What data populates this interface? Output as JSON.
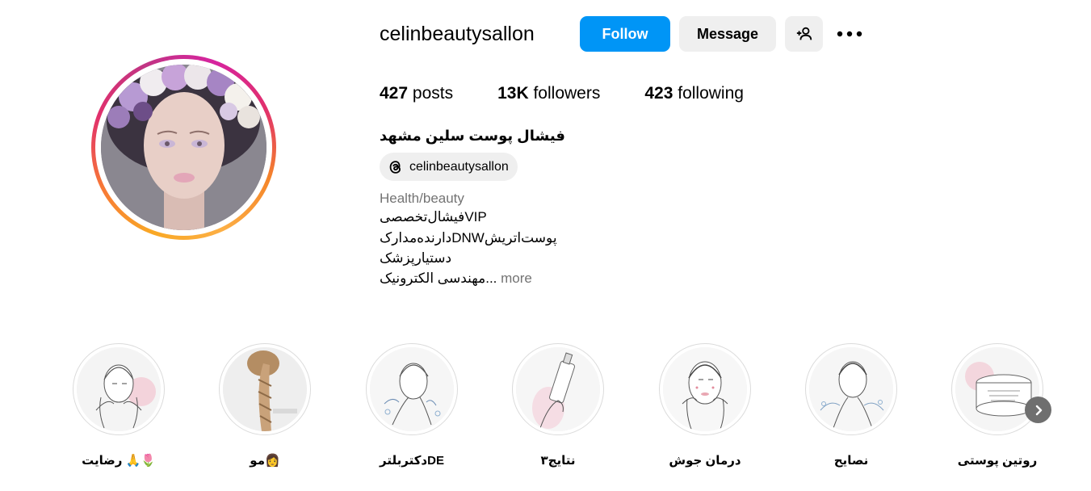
{
  "profile": {
    "username": "celinbeautysallon",
    "follow_label": "Follow",
    "message_label": "Message",
    "posts_count": "427",
    "posts_label": "posts",
    "followers_count": "13K",
    "followers_label": "followers",
    "following_count": "423",
    "following_label": "following",
    "full_name": "فیشال پوست سلین مشهد",
    "threads_handle": "celinbeautysallon",
    "category": "Health/beauty",
    "bio": [
      "فیشال‌تخصصیVIP",
      "دارنده‌مدارکDNWپوست‌اتریش",
      "دستیارپزشک",
      "مهندسی الکترونیک..."
    ],
    "more_label": "more"
  },
  "highlights": [
    {
      "label": "رضایت 🙏🌷",
      "icon": "face-care-sketch"
    },
    {
      "label": "مو👩",
      "icon": "braid-sketch"
    },
    {
      "label": "دکتربلترDE",
      "icon": "face-wash-sketch"
    },
    {
      "label": "نتایج۳",
      "icon": "serum-bottle-sketch"
    },
    {
      "label": "درمان جوش",
      "icon": "acne-face-sketch"
    },
    {
      "label": "نصایح",
      "icon": "face-splash-sketch"
    },
    {
      "label": "روتین پوستی",
      "icon": "cream-jar-sketch"
    }
  ],
  "colors": {
    "accent": "#0095f6",
    "secondary_button": "#efefef",
    "muted_text": "#737373"
  }
}
